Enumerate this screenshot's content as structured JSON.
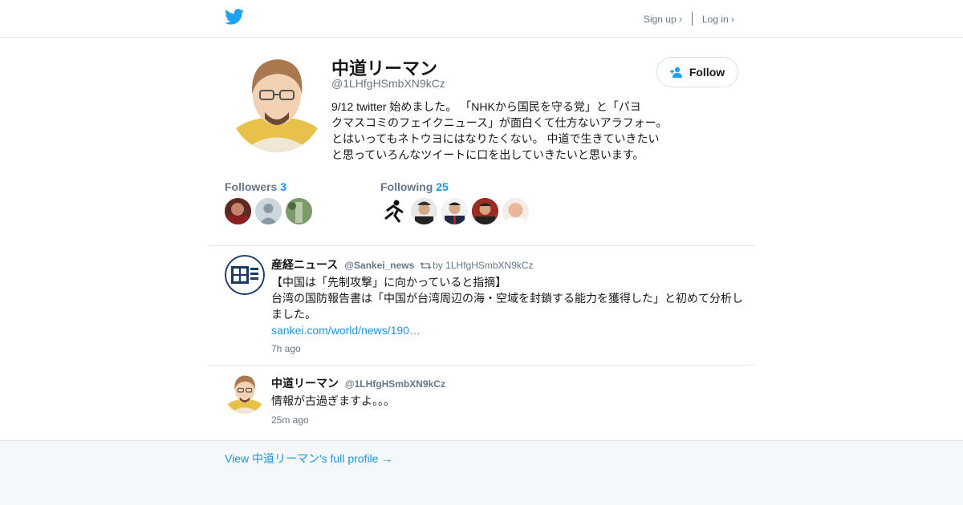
{
  "colors": {
    "twitter_blue": "#1da1f2",
    "link": "#1b95e0",
    "muted": "#657786"
  },
  "header": {
    "logo_icon": "twitter-bird-icon",
    "signup": "Sign up ›",
    "login": "Log in ›"
  },
  "profile": {
    "name": "中道リーマン",
    "handle": "@1LHfgHSmbXN9kCz",
    "bio": "9/12 twitter 始めました。 「NHKから国民を守る党」と「パヨ\nクマスコミのフェイクニュース」が面白くて仕方ないアラフォー。\nとはいってもネトウヨにはなりたくない。 中道で生きていきたい\nと思っていろんなツイートに口を出していきたいと思います。",
    "follow_label": "Follow",
    "followers_label": "Followers",
    "followers_count": "3",
    "following_label": "Following",
    "following_count": "25"
  },
  "tweets": [
    {
      "name": "産経ニュース",
      "handle": "@Sankei_news",
      "retweet": "by 1LHfgHSmbXN9kCz",
      "line1": "【中国は「先制攻撃」に向かっていると指摘】",
      "line2": "台湾の国防報告書は「中国が台湾周辺の海・空域を封鎖する能力を獲得した」と初めて分析し",
      "line3": "ました。",
      "link": "sankei.com/world/news/190…",
      "time": "7h ago"
    },
    {
      "name": "中道リーマン",
      "handle": "@1LHfgHSmbXN9kCz",
      "text": "情報が古過ぎますよ。。。",
      "time": "25m ago"
    }
  ],
  "footer": {
    "link": "View 中道リーマン's full profile →"
  }
}
